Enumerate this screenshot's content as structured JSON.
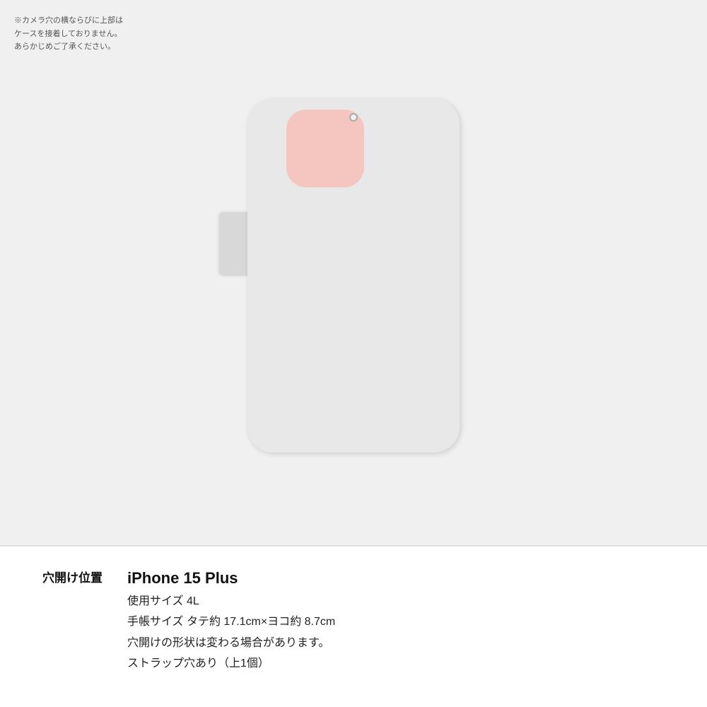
{
  "page": {
    "background_color": "#f0f0f0",
    "note_text": "※カメラ穴の横ならびに上部は\nケースを接着しておりません。\nあらかじめご了承ください。",
    "info_label": "穴開け位置",
    "device_name": "iPhone 15 Plus",
    "size_label": "使用サイズ 4L",
    "dimensions_label": "手帳サイズ タテ約 17.1cm×ヨコ約 8.7cm",
    "shape_note": "穴開けの形状は変わる場合があります。",
    "strap_note": "ストラップ穴あり（上1個）"
  },
  "case": {
    "color": "#e8e8e8",
    "strap_tab_color": "#d0d0d0",
    "camera_area_color": "#f5c5c0"
  }
}
